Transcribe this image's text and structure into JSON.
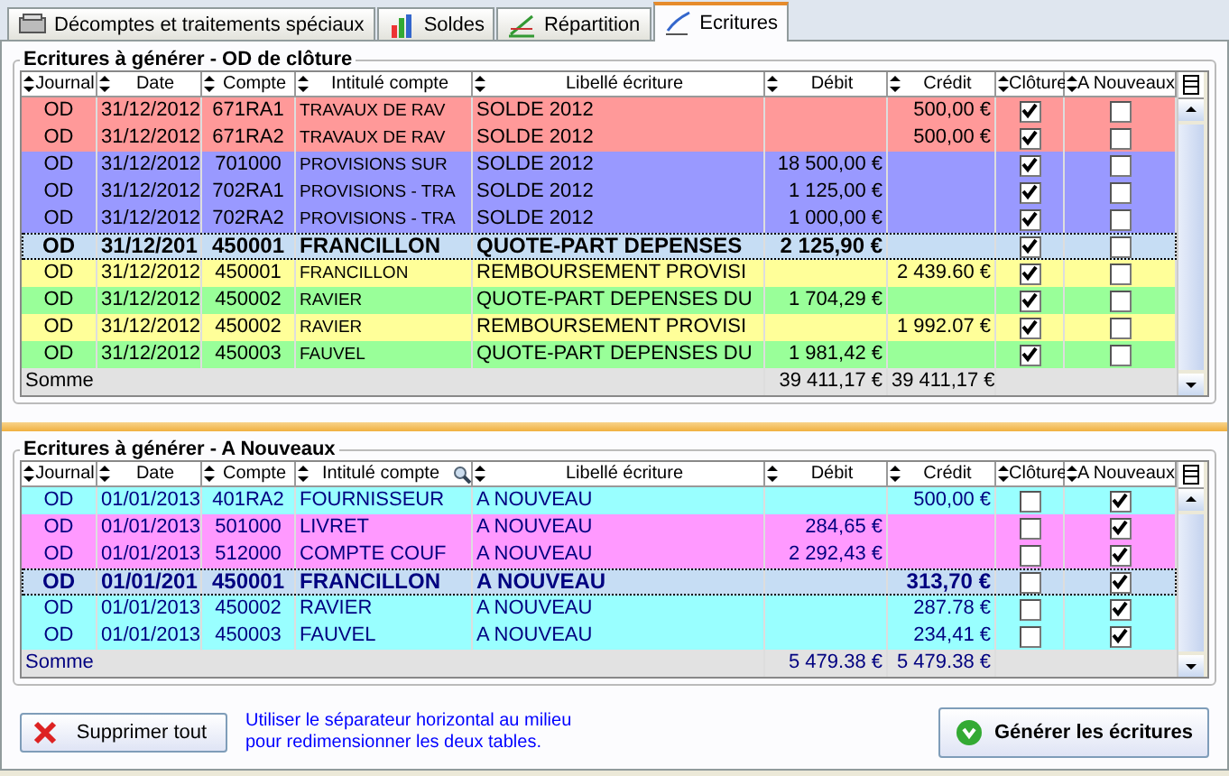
{
  "tabs": [
    {
      "label": "Décomptes et traitements spéciaux",
      "selected": false
    },
    {
      "label": "Soldes",
      "selected": false
    },
    {
      "label": "Répartition",
      "selected": false
    },
    {
      "label": "Ecritures",
      "selected": true
    }
  ],
  "tables": [
    {
      "title": "Ecritures à générer - OD de clôture",
      "columns": [
        "Journal",
        "Date",
        "Compte",
        "Intitulé compte",
        "Libellé écriture",
        "Débit",
        "Crédit",
        "Clôture",
        "A Nouveaux"
      ],
      "search_column": false,
      "rows": [
        {
          "journal": "OD",
          "date": "31/12/2012",
          "compte": "671RA1",
          "intitule": "TRAVAUX DE RAV",
          "libelle": "SOLDE 2012",
          "credit": "500,00 €",
          "cloture": true,
          "a_nouveau": false,
          "color": "#ff9999",
          "selected": false
        },
        {
          "journal": "OD",
          "date": "31/12/2012",
          "compte": "671RA2",
          "intitule": "TRAVAUX DE RAV",
          "libelle": "SOLDE 2012",
          "credit": "500,00 €",
          "cloture": true,
          "a_nouveau": false,
          "color": "#ff9999",
          "selected": false
        },
        {
          "journal": "OD",
          "date": "31/12/2012",
          "compte": "701000",
          "intitule": "PROVISIONS SUR",
          "libelle": "SOLDE 2012",
          "debit": "18 500,00 €",
          "cloture": true,
          "a_nouveau": false,
          "color": "#9999ff",
          "selected": false
        },
        {
          "journal": "OD",
          "date": "31/12/2012",
          "compte": "702RA1",
          "intitule": "PROVISIONS - TRA",
          "libelle": "SOLDE 2012",
          "debit": "1 125,00 €",
          "cloture": true,
          "a_nouveau": false,
          "color": "#9999ff",
          "selected": false
        },
        {
          "journal": "OD",
          "date": "31/12/2012",
          "compte": "702RA2",
          "intitule": "PROVISIONS - TRA",
          "libelle": "SOLDE 2012",
          "debit": "1 000,00 €",
          "cloture": true,
          "a_nouveau": false,
          "color": "#9999ff",
          "selected": false
        },
        {
          "journal": "OD",
          "date": "31/12/201",
          "compte": "450001",
          "intitule": "FRANCILLON",
          "libelle": "QUOTE-PART DEPENSES",
          "debit": "2 125,90 €",
          "cloture": true,
          "a_nouveau": false,
          "color": "#c6ddf4",
          "selected": true
        },
        {
          "journal": "OD",
          "date": "31/12/2012",
          "compte": "450001",
          "intitule": "FRANCILLON",
          "libelle": "REMBOURSEMENT PROVISI",
          "credit": "2 439.60 €",
          "cloture": true,
          "a_nouveau": false,
          "color": "#ffff99",
          "selected": false
        },
        {
          "journal": "OD",
          "date": "31/12/2012",
          "compte": "450002",
          "intitule": "RAVIER",
          "libelle": "QUOTE-PART DEPENSES DU",
          "debit": "1 704,29 €",
          "cloture": true,
          "a_nouveau": false,
          "color": "#99ff99",
          "selected": false
        },
        {
          "journal": "OD",
          "date": "31/12/2012",
          "compte": "450002",
          "intitule": "RAVIER",
          "libelle": "REMBOURSEMENT PROVISI",
          "credit": "1 992.07 €",
          "cloture": true,
          "a_nouveau": false,
          "color": "#ffff99",
          "selected": false
        },
        {
          "journal": "OD",
          "date": "31/12/2012",
          "compte": "450003",
          "intitule": "FAUVEL",
          "libelle": "QUOTE-PART DEPENSES DU",
          "debit": "1 981,42 €",
          "cloture": true,
          "a_nouveau": false,
          "color": "#99ff99",
          "selected": false
        }
      ],
      "total": {
        "label": "Somme",
        "debit": "39 411,17 €",
        "credit": "39 411,17 €"
      }
    },
    {
      "title": "Ecritures à générer - A Nouveaux",
      "columns": [
        "Journal",
        "Date",
        "Compte",
        "Intitulé compte",
        "Libellé écriture",
        "Débit",
        "Crédit",
        "Clôture",
        "A Nouveaux"
      ],
      "search_column": true,
      "rows": [
        {
          "journal": "OD",
          "date": "01/01/2013",
          "compte": "401RA2",
          "intitule": "FOURNISSEUR",
          "libelle": "A NOUVEAU",
          "credit": "500,00 €",
          "cloture": false,
          "a_nouveau": true,
          "color": "#99ffff",
          "selected": false
        },
        {
          "journal": "OD",
          "date": "01/01/2013",
          "compte": "501000",
          "intitule": "LIVRET",
          "libelle": "A NOUVEAU",
          "debit": "284,65 €",
          "cloture": false,
          "a_nouveau": true,
          "color": "#ff99ff",
          "selected": false
        },
        {
          "journal": "OD",
          "date": "01/01/2013",
          "compte": "512000",
          "intitule": "COMPTE COUF",
          "libelle": "A NOUVEAU",
          "debit": "2 292,43 €",
          "cloture": false,
          "a_nouveau": true,
          "color": "#ff99ff",
          "selected": false
        },
        {
          "journal": "OD",
          "date": "01/01/201",
          "compte": "450001",
          "intitule": "FRANCILLON",
          "libelle": "A NOUVEAU",
          "credit": "313,70 €",
          "cloture": false,
          "a_nouveau": true,
          "color": "#c6ddf4",
          "selected": true
        },
        {
          "journal": "OD",
          "date": "01/01/2013",
          "compte": "450002",
          "intitule": "RAVIER",
          "libelle": "A NOUVEAU",
          "credit": "287.78 €",
          "cloture": false,
          "a_nouveau": true,
          "color": "#99ffff",
          "selected": false
        },
        {
          "journal": "OD",
          "date": "01/01/2013",
          "compte": "450003",
          "intitule": "FAUVEL",
          "libelle": "A NOUVEAU",
          "credit": "234,41 €",
          "cloture": false,
          "a_nouveau": true,
          "color": "#99ffff",
          "selected": false
        }
      ],
      "total": {
        "label": "Somme",
        "debit": "5 479.38 €",
        "credit": "5 479.38 €"
      }
    }
  ],
  "delete_button": "Supprimer tout",
  "hint": "Utiliser le séparateur horizontal au milieu\npour redimensionner les deux tables.",
  "generate_button": "Générer les écritures"
}
